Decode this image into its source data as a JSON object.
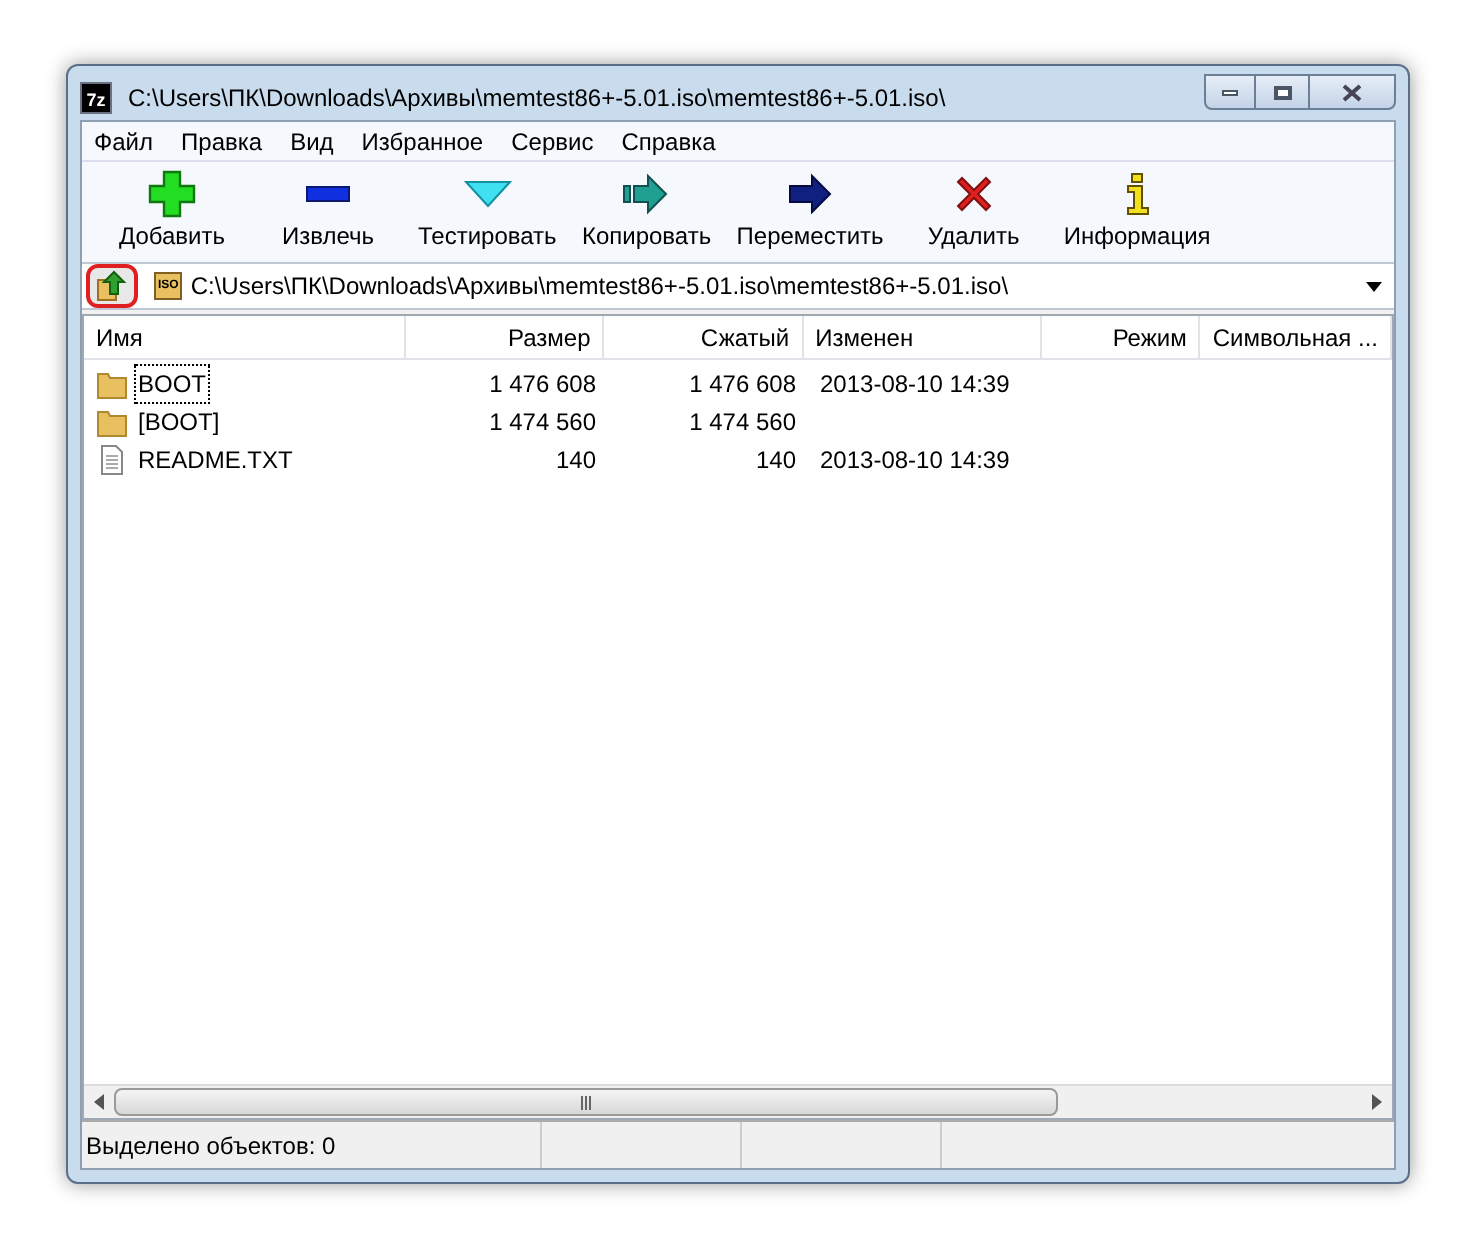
{
  "window": {
    "title": "C:\\Users\\ПК\\Downloads\\Архивы\\memtest86+-5.01.iso\\memtest86+-5.01.iso\\",
    "app_icon": "7z"
  },
  "menu": [
    "Файл",
    "Правка",
    "Вид",
    "Избранное",
    "Сервис",
    "Справка"
  ],
  "toolbar": [
    {
      "kind": "add",
      "label": "Добавить"
    },
    {
      "kind": "extract",
      "label": "Извлечь"
    },
    {
      "kind": "test",
      "label": "Тестировать"
    },
    {
      "kind": "copy",
      "label": "Копировать"
    },
    {
      "kind": "move",
      "label": "Переместить"
    },
    {
      "kind": "delete",
      "label": "Удалить"
    },
    {
      "kind": "info",
      "label": "Информация"
    }
  ],
  "address_bar": {
    "up_button_highlighted": true,
    "badge": "ISO",
    "path": "C:\\Users\\ПК\\Downloads\\Архивы\\memtest86+-5.01.iso\\memtest86+-5.01.iso\\"
  },
  "table": {
    "columns": [
      "Имя",
      "Размер",
      "Сжатый",
      "Изменен",
      "Режим",
      "Символьная ..."
    ],
    "rows": [
      {
        "kind": "folder",
        "focused": true,
        "name": "BOOT",
        "size": "1 476 608",
        "packed": "1 476 608",
        "modified": "2013-08-10 14:39"
      },
      {
        "kind": "folder",
        "focused": false,
        "name": "[BOOT]",
        "size": "1 474 560",
        "packed": "1 474 560"
      },
      {
        "kind": "file",
        "focused": false,
        "name": "README.TXT",
        "size": "140",
        "packed": "140",
        "modified": "2013-08-10 14:39"
      }
    ]
  },
  "status_bar": "Выделено объектов: 0"
}
